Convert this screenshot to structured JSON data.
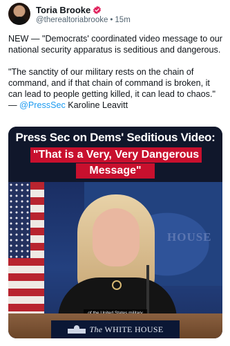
{
  "author": {
    "display_name": "Toria Brooke",
    "handle": "@therealtoriabrooke",
    "separator": "•",
    "time": "15m"
  },
  "post": {
    "para1": "NEW — \"Democrats' coordinated video message to our national security apparatus is seditious and dangerous.",
    "para2_text": "\"The sanctity of our military rests on the chain of command, and if that chain of command is broken, it can lead to people getting killed, it can lead to chaos.\"",
    "dash": "— ",
    "mention": "@PressSec",
    "mention_suffix": " Karoline Leavitt"
  },
  "media": {
    "headline_line1": "Press Sec on Dems' Seditious Video:",
    "headline_line2": "\"That is a Very, Very Dangerous",
    "headline_line3": "Message\"",
    "wall_text": "HOUSE",
    "subtitle": "of the United States military",
    "podium_text_prefix": "The",
    "podium_text_main": "WHITE HOUSE"
  },
  "colors": {
    "verified": "#e0245e",
    "link": "#1d9bf0",
    "headline_bg": "#c8102e"
  },
  "icons": {
    "verified": "verified-badge-icon",
    "whitehouse": "white-house-logo-icon"
  }
}
